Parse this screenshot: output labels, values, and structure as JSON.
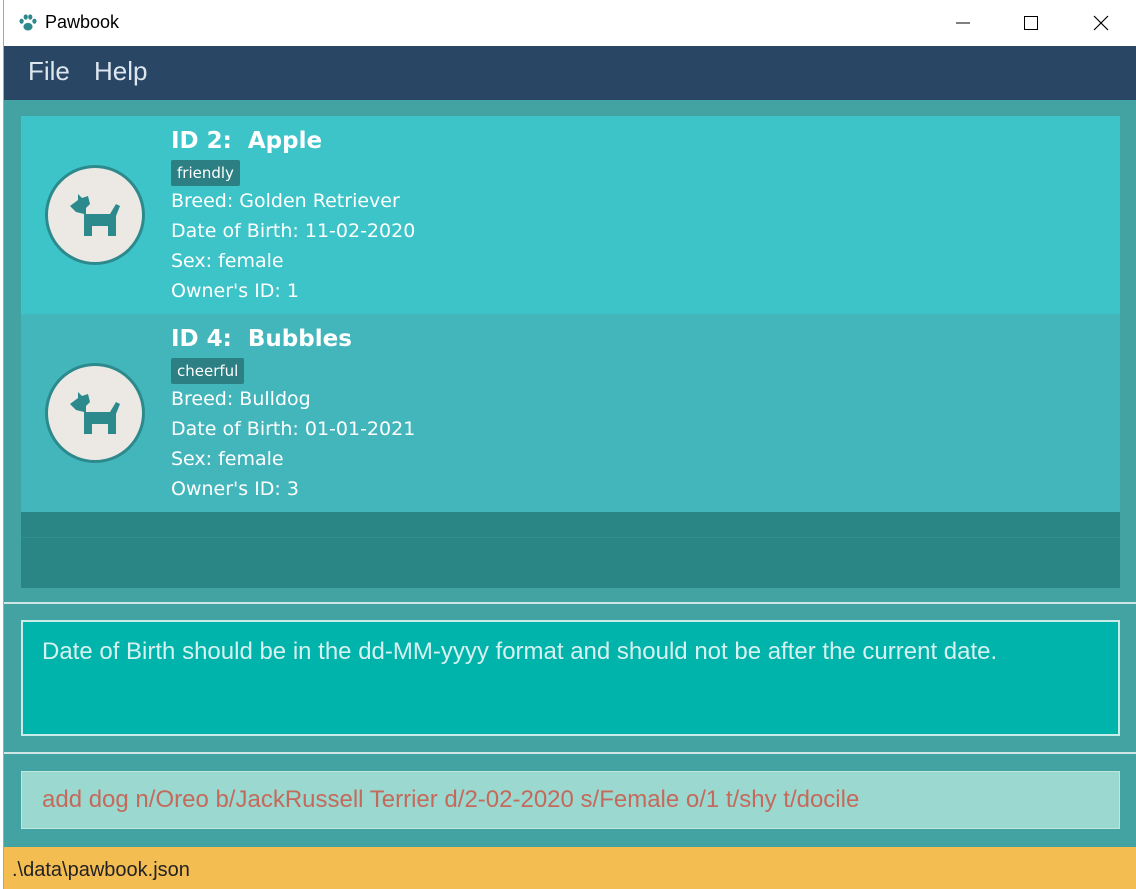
{
  "window": {
    "title": "Pawbook",
    "app_icon": "paw-icon",
    "controls": [
      "minimize-icon",
      "maximize-icon",
      "close-icon"
    ]
  },
  "menu": {
    "items": [
      {
        "label": "File"
      },
      {
        "label": "Help"
      }
    ]
  },
  "dogs": [
    {
      "title": "ID 2:  Apple",
      "tag": "friendly",
      "breed": "Breed: Golden Retriever",
      "dob": "Date of Birth: 11-02-2020",
      "sex": "Sex: female",
      "owner": "Owner's ID: 1",
      "icon": "dog-icon"
    },
    {
      "title": "ID 4:  Bubbles",
      "tag": "cheerful",
      "breed": "Breed: Bulldog",
      "dob": "Date of Birth: 01-01-2021",
      "sex": "Sex: female",
      "owner": "Owner's ID: 3",
      "icon": "dog-icon"
    }
  ],
  "result": {
    "text": "Date of Birth should be in the dd-MM-yyyy format and should not be after the current date."
  },
  "command": {
    "value": "add dog n/Oreo b/JackRussell Terrier d/2-02-2020 s/Female o/1 t/shy t/docile"
  },
  "status": {
    "path": ".\\data\\pawbook.json"
  },
  "colors": {
    "menubar": "#294664",
    "main_bg": "#43a3a3",
    "card_selected": "#3cc4c9",
    "card": "#43b6bc",
    "tag_bg": "#2c7f83",
    "result_bg": "#00b4ab",
    "command_bg": "#9bd8cf",
    "command_text_error": "#c46a5c",
    "statusbar": "#f4bd52"
  }
}
